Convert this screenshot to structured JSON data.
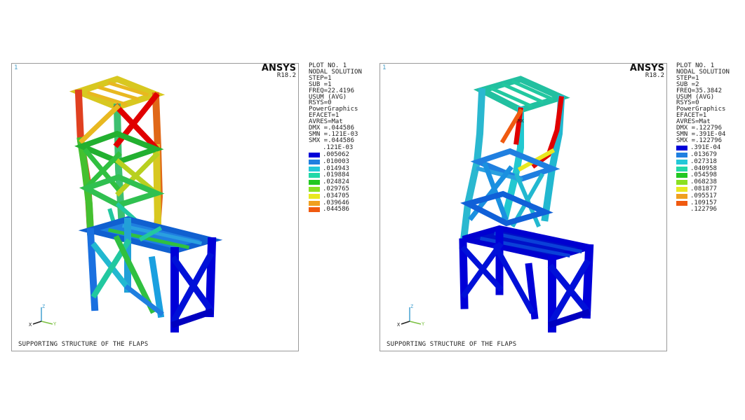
{
  "panels": [
    {
      "index_label": "1",
      "brand": "ANSYS",
      "version": "R18.2",
      "caption": "SUPPORTING STRUCTURE OF THE FLAPS",
      "info": [
        "PLOT NO.   1",
        "NODAL SOLUTION",
        "STEP=1",
        "SUB =1",
        "FREQ=22.4196",
        "USUM     (AVG)",
        "RSYS=0",
        "PowerGraphics",
        "EFACET=1",
        "AVRES=Mat",
        "DMX =.044586",
        "SMN =.121E-03",
        "SMX =.044586"
      ],
      "legend": [
        ".121E-03",
        ".005062",
        ".010003",
        ".014943",
        ".019884",
        ".024824",
        ".029765",
        ".034705",
        ".039646",
        ".044586"
      ]
    },
    {
      "index_label": "1",
      "brand": "ANSYS",
      "version": "R18.2",
      "caption": "SUPPORTING STRUCTURE OF THE FLAPS",
      "annotation": "MX",
      "info": [
        "PLOT NO.   1",
        "NODAL SOLUTION",
        "STEP=1",
        "SUB =2",
        "FREQ=35.3842",
        "USUM     (AVG)",
        "RSYS=0",
        "PowerGraphics",
        "EFACET=1",
        "AVRES=Mat",
        "DMX =.122796",
        "SMN =.391E-04",
        "SMX =.122796"
      ],
      "legend": [
        ".391E-04",
        ".013679",
        ".027318",
        ".040958",
        ".054598",
        ".068238",
        ".081877",
        ".095517",
        ".109157",
        ".122796"
      ]
    }
  ],
  "triad": {
    "z": "Z",
    "y": "Y",
    "x": "X"
  },
  "legend_colors": [
    "#0000d8",
    "#1f7fe0",
    "#22c8d8",
    "#22d8a8",
    "#22c822",
    "#8ae022",
    "#e8e820",
    "#f0a020",
    "#f05a10",
    "#e00000"
  ]
}
